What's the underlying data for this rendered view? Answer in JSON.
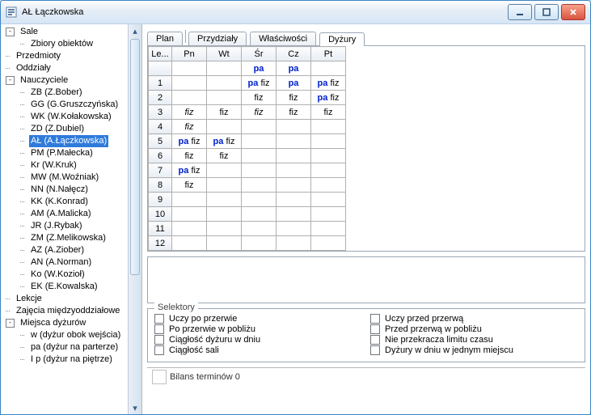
{
  "window": {
    "title": "AŁ Łączkowska"
  },
  "tree": {
    "nodes": [
      {
        "level": 0,
        "expander": "-",
        "label": "Sale"
      },
      {
        "level": 1,
        "expander": "",
        "label": "Zbiory obiektów"
      },
      {
        "level": 0,
        "expander": "",
        "label": "Przedmioty"
      },
      {
        "level": 0,
        "expander": "",
        "label": "Oddziały"
      },
      {
        "level": 0,
        "expander": "-",
        "label": "Nauczyciele"
      },
      {
        "level": 1,
        "expander": "",
        "label": "ZB (Z.Bober)"
      },
      {
        "level": 1,
        "expander": "",
        "label": "GG (G.Gruszczyńska)"
      },
      {
        "level": 1,
        "expander": "",
        "label": "WK (W.Kołakowska)"
      },
      {
        "level": 1,
        "expander": "",
        "label": "ZD (Z.Dubiel)"
      },
      {
        "level": 1,
        "expander": "",
        "label": "AŁ (A.Łączkowska)",
        "selected": true
      },
      {
        "level": 1,
        "expander": "",
        "label": "PM (P.Małecka)"
      },
      {
        "level": 1,
        "expander": "",
        "label": "Kr (W.Kruk)"
      },
      {
        "level": 1,
        "expander": "",
        "label": "MW (M.Woźniak)"
      },
      {
        "level": 1,
        "expander": "",
        "label": "NN (N.Nałęcz)"
      },
      {
        "level": 1,
        "expander": "",
        "label": "KK (K.Konrad)"
      },
      {
        "level": 1,
        "expander": "",
        "label": "AM (A.Malicka)"
      },
      {
        "level": 1,
        "expander": "",
        "label": "JR (J.Rybak)"
      },
      {
        "level": 1,
        "expander": "",
        "label": "ZM (Z.Melikowska)"
      },
      {
        "level": 1,
        "expander": "",
        "label": "AZ (A.Ziober)"
      },
      {
        "level": 1,
        "expander": "",
        "label": "AN (A.Norman)"
      },
      {
        "level": 1,
        "expander": "",
        "label": "Ko (W.Kozioł)"
      },
      {
        "level": 1,
        "expander": "",
        "label": "EK (E.Kowalska)"
      },
      {
        "level": 0,
        "expander": "",
        "label": "Lekcje"
      },
      {
        "level": 0,
        "expander": "",
        "label": "Zajęcia międzyoddziałowe"
      },
      {
        "level": 0,
        "expander": "-",
        "label": "Miejsca dyżurów"
      },
      {
        "level": 1,
        "expander": "",
        "label": "w (dyżur obok wejścia)"
      },
      {
        "level": 1,
        "expander": "",
        "label": "pa (dyżur na parterze)"
      },
      {
        "level": 1,
        "expander": "",
        "label": "I p (dyżur na piętrze)"
      }
    ]
  },
  "tabs": [
    {
      "label": "Plan",
      "active": false
    },
    {
      "label": "Przydziały",
      "active": false
    },
    {
      "label": "Właściwości",
      "active": false
    },
    {
      "label": "Dyżury",
      "active": true
    }
  ],
  "schedule": {
    "header_first": "Le...",
    "days": [
      "Pn",
      "Wt",
      "Śr",
      "Cz",
      "Pt"
    ],
    "row_labels": [
      "",
      "1",
      "2",
      "3",
      "4",
      "5",
      "6",
      "7",
      "8",
      "9",
      "10",
      "11",
      "12"
    ],
    "cells": [
      [
        [],
        [],
        [
          {
            "t": "pa",
            "c": "pa"
          }
        ],
        [
          {
            "t": "pa",
            "c": "pa"
          }
        ],
        []
      ],
      [
        [],
        [],
        [
          {
            "t": "pa",
            "c": "pa"
          },
          {
            "t": " fiz",
            "c": "fiz"
          }
        ],
        [
          {
            "t": "pa",
            "c": "pa"
          }
        ],
        [
          {
            "t": "pa",
            "c": "pa"
          },
          {
            "t": " fiz",
            "c": "fiz"
          }
        ]
      ],
      [
        [],
        [],
        [
          {
            "t": "fiz",
            "c": "fiz"
          }
        ],
        [
          {
            "t": "fiz",
            "c": "fiz"
          }
        ],
        [
          {
            "t": "pa",
            "c": "pa"
          },
          {
            "t": " fiz",
            "c": "fiz"
          }
        ]
      ],
      [
        [
          {
            "t": "fiz",
            "c": "fiz it"
          }
        ],
        [
          {
            "t": "fiz",
            "c": "fiz"
          }
        ],
        [
          {
            "t": "fiz",
            "c": "fiz it"
          }
        ],
        [
          {
            "t": "fiz",
            "c": "fiz"
          }
        ],
        [
          {
            "t": "fiz",
            "c": "fiz"
          }
        ]
      ],
      [
        [
          {
            "t": "fiz",
            "c": "fiz it"
          }
        ],
        [],
        [],
        [],
        []
      ],
      [
        [
          {
            "t": "pa",
            "c": "pa"
          },
          {
            "t": " fiz",
            "c": "fiz"
          }
        ],
        [
          {
            "t": "pa",
            "c": "pa"
          },
          {
            "t": " fiz",
            "c": "fiz"
          }
        ],
        [],
        [],
        []
      ],
      [
        [
          {
            "t": "fiz",
            "c": "fiz"
          }
        ],
        [
          {
            "t": "fiz",
            "c": "fiz"
          }
        ],
        [],
        [],
        []
      ],
      [
        [
          {
            "t": "pa",
            "c": "pa"
          },
          {
            "t": " fiz",
            "c": "fiz"
          }
        ],
        [],
        [],
        [],
        []
      ],
      [
        [
          {
            "t": "fiz",
            "c": "fiz"
          }
        ],
        [],
        [],
        [],
        []
      ],
      [
        [],
        [],
        [],
        [],
        []
      ],
      [
        [],
        [],
        [],
        [],
        []
      ],
      [
        [],
        [],
        [],
        [],
        []
      ],
      [
        [],
        [],
        [],
        [],
        []
      ]
    ]
  },
  "selectors": {
    "legend": "Selektory",
    "items": [
      {
        "label": "Uczy po przerwie"
      },
      {
        "label": "Uczy przed przerwą"
      },
      {
        "label": "Po przerwie w pobliżu"
      },
      {
        "label": "Przed przerwą w pobliżu"
      },
      {
        "label": "Ciągłość dyżuru w dniu"
      },
      {
        "label": "Nie przekracza limitu czasu"
      },
      {
        "label": "Ciągłość sali"
      },
      {
        "label": "Dyżury w dniu w jednym miejscu"
      }
    ]
  },
  "status": {
    "text": "Bilans terminów 0"
  }
}
